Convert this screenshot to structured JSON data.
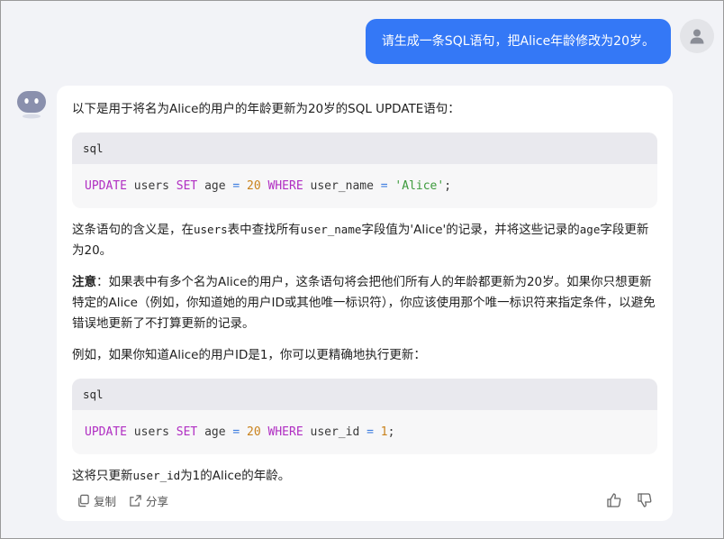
{
  "user_message": {
    "text": "请生成一条SQL语句，把Alice年龄修改为20岁。"
  },
  "answer": {
    "intro": "以下是用于将名为Alice的用户的年龄更新为20岁的SQL UPDATE语句：",
    "code_blocks": [
      {
        "language": "sql",
        "tokens": [
          "UPDATE",
          " users ",
          "SET",
          " age ",
          "=",
          " ",
          "20",
          " ",
          "WHERE",
          " user_name ",
          "=",
          " ",
          "'Alice'",
          ";"
        ]
      },
      {
        "language": "sql",
        "tokens": [
          "UPDATE",
          " users ",
          "SET",
          " age ",
          "=",
          " ",
          "20",
          " ",
          "WHERE",
          " user_id ",
          "=",
          " ",
          "1",
          ";"
        ]
      }
    ],
    "meaning": {
      "part1": "这条语句的含义是，在",
      "code1": "users",
      "part2": "表中查找所有",
      "code2": "user_name",
      "part3": "字段值为'Alice'的记录，并将这些记录的",
      "code3": "age",
      "part4": "字段更新为20。"
    },
    "note": {
      "label": "注意",
      "text": "：如果表中有多个名为Alice的用户，这条语句将会把他们所有人的年龄都更新为20岁。如果你只想更新特定的Alice（例如，你知道她的用户ID或其他唯一标识符），你应该使用那个唯一标识符来指定条件，以避免错误地更新了不打算更新的记录。"
    },
    "example_intro": "例如，如果你知道Alice的用户ID是1，你可以更精确地执行更新：",
    "closing": {
      "part1": "这将只更新",
      "code": "user_id",
      "part2": "为1的Alice的年龄。"
    }
  },
  "footer": {
    "copy_label": "复制",
    "share_label": "分享"
  },
  "colors": {
    "user_bubble": "#3478f6",
    "background": "#f2f3f7",
    "keyword": "#b02ec2",
    "operator": "#3e7ee0",
    "number": "#c9821c",
    "string": "#3c9a3c"
  },
  "icons": {
    "user_avatar": "person-icon",
    "bot_avatar": "robot-icon",
    "copy": "copy-icon",
    "share": "share-icon",
    "like": "thumbs-up-icon",
    "dislike": "thumbs-down-icon"
  }
}
